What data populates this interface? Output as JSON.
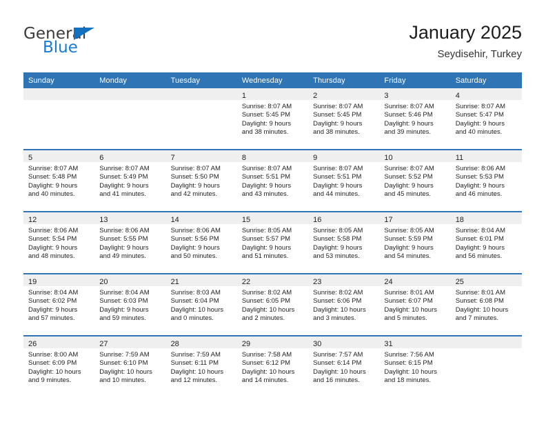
{
  "brand": {
    "name_top": "General",
    "name_bottom": "Blue",
    "accent_color": "#1a7ad4",
    "triangle_color": "#1570c0"
  },
  "header": {
    "title": "January 2025",
    "subtitle": "Seydisehir, Turkey"
  },
  "theme": {
    "header_row_bg": "#2f74b5",
    "daynum_band_bg": "#efefef",
    "row_divider": "#2f74b5",
    "text_color": "#222222"
  },
  "calendar": {
    "weekday_headers": [
      "Sunday",
      "Monday",
      "Tuesday",
      "Wednesday",
      "Thursday",
      "Friday",
      "Saturday"
    ],
    "weeks": [
      [
        {
          "day": "",
          "lines": []
        },
        {
          "day": "",
          "lines": []
        },
        {
          "day": "",
          "lines": []
        },
        {
          "day": "1",
          "lines": [
            "Sunrise: 8:07 AM",
            "Sunset: 5:45 PM",
            "Daylight: 9 hours",
            "and 38 minutes."
          ]
        },
        {
          "day": "2",
          "lines": [
            "Sunrise: 8:07 AM",
            "Sunset: 5:45 PM",
            "Daylight: 9 hours",
            "and 38 minutes."
          ]
        },
        {
          "day": "3",
          "lines": [
            "Sunrise: 8:07 AM",
            "Sunset: 5:46 PM",
            "Daylight: 9 hours",
            "and 39 minutes."
          ]
        },
        {
          "day": "4",
          "lines": [
            "Sunrise: 8:07 AM",
            "Sunset: 5:47 PM",
            "Daylight: 9 hours",
            "and 40 minutes."
          ]
        }
      ],
      [
        {
          "day": "5",
          "lines": [
            "Sunrise: 8:07 AM",
            "Sunset: 5:48 PM",
            "Daylight: 9 hours",
            "and 40 minutes."
          ]
        },
        {
          "day": "6",
          "lines": [
            "Sunrise: 8:07 AM",
            "Sunset: 5:49 PM",
            "Daylight: 9 hours",
            "and 41 minutes."
          ]
        },
        {
          "day": "7",
          "lines": [
            "Sunrise: 8:07 AM",
            "Sunset: 5:50 PM",
            "Daylight: 9 hours",
            "and 42 minutes."
          ]
        },
        {
          "day": "8",
          "lines": [
            "Sunrise: 8:07 AM",
            "Sunset: 5:51 PM",
            "Daylight: 9 hours",
            "and 43 minutes."
          ]
        },
        {
          "day": "9",
          "lines": [
            "Sunrise: 8:07 AM",
            "Sunset: 5:51 PM",
            "Daylight: 9 hours",
            "and 44 minutes."
          ]
        },
        {
          "day": "10",
          "lines": [
            "Sunrise: 8:07 AM",
            "Sunset: 5:52 PM",
            "Daylight: 9 hours",
            "and 45 minutes."
          ]
        },
        {
          "day": "11",
          "lines": [
            "Sunrise: 8:06 AM",
            "Sunset: 5:53 PM",
            "Daylight: 9 hours",
            "and 46 minutes."
          ]
        }
      ],
      [
        {
          "day": "12",
          "lines": [
            "Sunrise: 8:06 AM",
            "Sunset: 5:54 PM",
            "Daylight: 9 hours",
            "and 48 minutes."
          ]
        },
        {
          "day": "13",
          "lines": [
            "Sunrise: 8:06 AM",
            "Sunset: 5:55 PM",
            "Daylight: 9 hours",
            "and 49 minutes."
          ]
        },
        {
          "day": "14",
          "lines": [
            "Sunrise: 8:06 AM",
            "Sunset: 5:56 PM",
            "Daylight: 9 hours",
            "and 50 minutes."
          ]
        },
        {
          "day": "15",
          "lines": [
            "Sunrise: 8:05 AM",
            "Sunset: 5:57 PM",
            "Daylight: 9 hours",
            "and 51 minutes."
          ]
        },
        {
          "day": "16",
          "lines": [
            "Sunrise: 8:05 AM",
            "Sunset: 5:58 PM",
            "Daylight: 9 hours",
            "and 53 minutes."
          ]
        },
        {
          "day": "17",
          "lines": [
            "Sunrise: 8:05 AM",
            "Sunset: 5:59 PM",
            "Daylight: 9 hours",
            "and 54 minutes."
          ]
        },
        {
          "day": "18",
          "lines": [
            "Sunrise: 8:04 AM",
            "Sunset: 6:01 PM",
            "Daylight: 9 hours",
            "and 56 minutes."
          ]
        }
      ],
      [
        {
          "day": "19",
          "lines": [
            "Sunrise: 8:04 AM",
            "Sunset: 6:02 PM",
            "Daylight: 9 hours",
            "and 57 minutes."
          ]
        },
        {
          "day": "20",
          "lines": [
            "Sunrise: 8:04 AM",
            "Sunset: 6:03 PM",
            "Daylight: 9 hours",
            "and 59 minutes."
          ]
        },
        {
          "day": "21",
          "lines": [
            "Sunrise: 8:03 AM",
            "Sunset: 6:04 PM",
            "Daylight: 10 hours",
            "and 0 minutes."
          ]
        },
        {
          "day": "22",
          "lines": [
            "Sunrise: 8:02 AM",
            "Sunset: 6:05 PM",
            "Daylight: 10 hours",
            "and 2 minutes."
          ]
        },
        {
          "day": "23",
          "lines": [
            "Sunrise: 8:02 AM",
            "Sunset: 6:06 PM",
            "Daylight: 10 hours",
            "and 3 minutes."
          ]
        },
        {
          "day": "24",
          "lines": [
            "Sunrise: 8:01 AM",
            "Sunset: 6:07 PM",
            "Daylight: 10 hours",
            "and 5 minutes."
          ]
        },
        {
          "day": "25",
          "lines": [
            "Sunrise: 8:01 AM",
            "Sunset: 6:08 PM",
            "Daylight: 10 hours",
            "and 7 minutes."
          ]
        }
      ],
      [
        {
          "day": "26",
          "lines": [
            "Sunrise: 8:00 AM",
            "Sunset: 6:09 PM",
            "Daylight: 10 hours",
            "and 9 minutes."
          ]
        },
        {
          "day": "27",
          "lines": [
            "Sunrise: 7:59 AM",
            "Sunset: 6:10 PM",
            "Daylight: 10 hours",
            "and 10 minutes."
          ]
        },
        {
          "day": "28",
          "lines": [
            "Sunrise: 7:59 AM",
            "Sunset: 6:11 PM",
            "Daylight: 10 hours",
            "and 12 minutes."
          ]
        },
        {
          "day": "29",
          "lines": [
            "Sunrise: 7:58 AM",
            "Sunset: 6:12 PM",
            "Daylight: 10 hours",
            "and 14 minutes."
          ]
        },
        {
          "day": "30",
          "lines": [
            "Sunrise: 7:57 AM",
            "Sunset: 6:14 PM",
            "Daylight: 10 hours",
            "and 16 minutes."
          ]
        },
        {
          "day": "31",
          "lines": [
            "Sunrise: 7:56 AM",
            "Sunset: 6:15 PM",
            "Daylight: 10 hours",
            "and 18 minutes."
          ]
        },
        {
          "day": "",
          "lines": []
        }
      ]
    ]
  }
}
